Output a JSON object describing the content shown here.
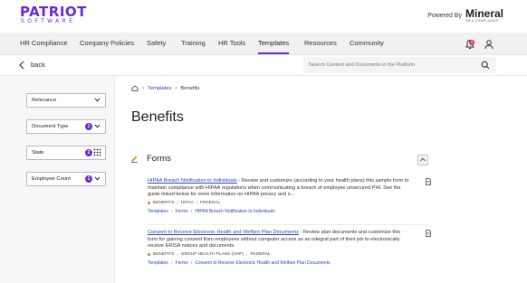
{
  "brand": {
    "name": "PATRIOT",
    "sub": "SOFTWARE"
  },
  "powered": {
    "label": "Powered By",
    "partner": "Mineral",
    "partner_sub": "HR & COMPLIANCE"
  },
  "nav": {
    "items": [
      "HR Compliance",
      "Company Policies",
      "Safety",
      "Training",
      "HR Tools",
      "Templates",
      "Resources",
      "Community"
    ],
    "active": "Templates",
    "notification_count": "1"
  },
  "backbar": {
    "back_label": "back",
    "search_placeholder": "Search Content and Documents in the Platform"
  },
  "filters": {
    "sort": {
      "label": "Relevance"
    },
    "document_type": {
      "label": "Document Type",
      "badge": "1"
    },
    "state": {
      "label": "State",
      "badge": "2"
    },
    "employee_count": {
      "label": "Employee Count",
      "badge": "1"
    }
  },
  "breadcrumb": {
    "templates": "Templates",
    "current": "Benefits"
  },
  "page": {
    "title": "Benefits"
  },
  "section": {
    "title": "Forms"
  },
  "items": [
    {
      "title": "HIPAA Breach Notification to Individuals",
      "description": " - Review and customize (according to your health plans) this sample form to maintain compliance with HIPAA regulations when communicating a breach of employee unsecured PHI. See the guide linked below for more information on HIPAA privacy and s...",
      "category": "BENEFITS",
      "tags": [
        "HIPAA",
        "FEDERAL"
      ],
      "crumb": [
        "Templates",
        "Forms",
        "HIPAA Breach Notification to Individuals"
      ]
    },
    {
      "title": "Consent to Receive Electronic Health and Welfare Plan Documents",
      "description": " - Review plan documents and customize this form for gaining consent from employees without computer access as an integral part of their job to electronically receive ERISA notices and documents.",
      "category": "BENEFITS",
      "tags": [
        "GROUP HEALTH PLANS (GHP)",
        "FEDERAL"
      ],
      "crumb": [
        "Templates",
        "Forms",
        "Consent to Receive Electronic Health and Welfare Plan Documents"
      ]
    }
  ],
  "colors": {
    "brand": "#6b2bd0",
    "link": "#2c46b8",
    "alert": "#d62a4a",
    "category_dot": "#d77b2b"
  }
}
